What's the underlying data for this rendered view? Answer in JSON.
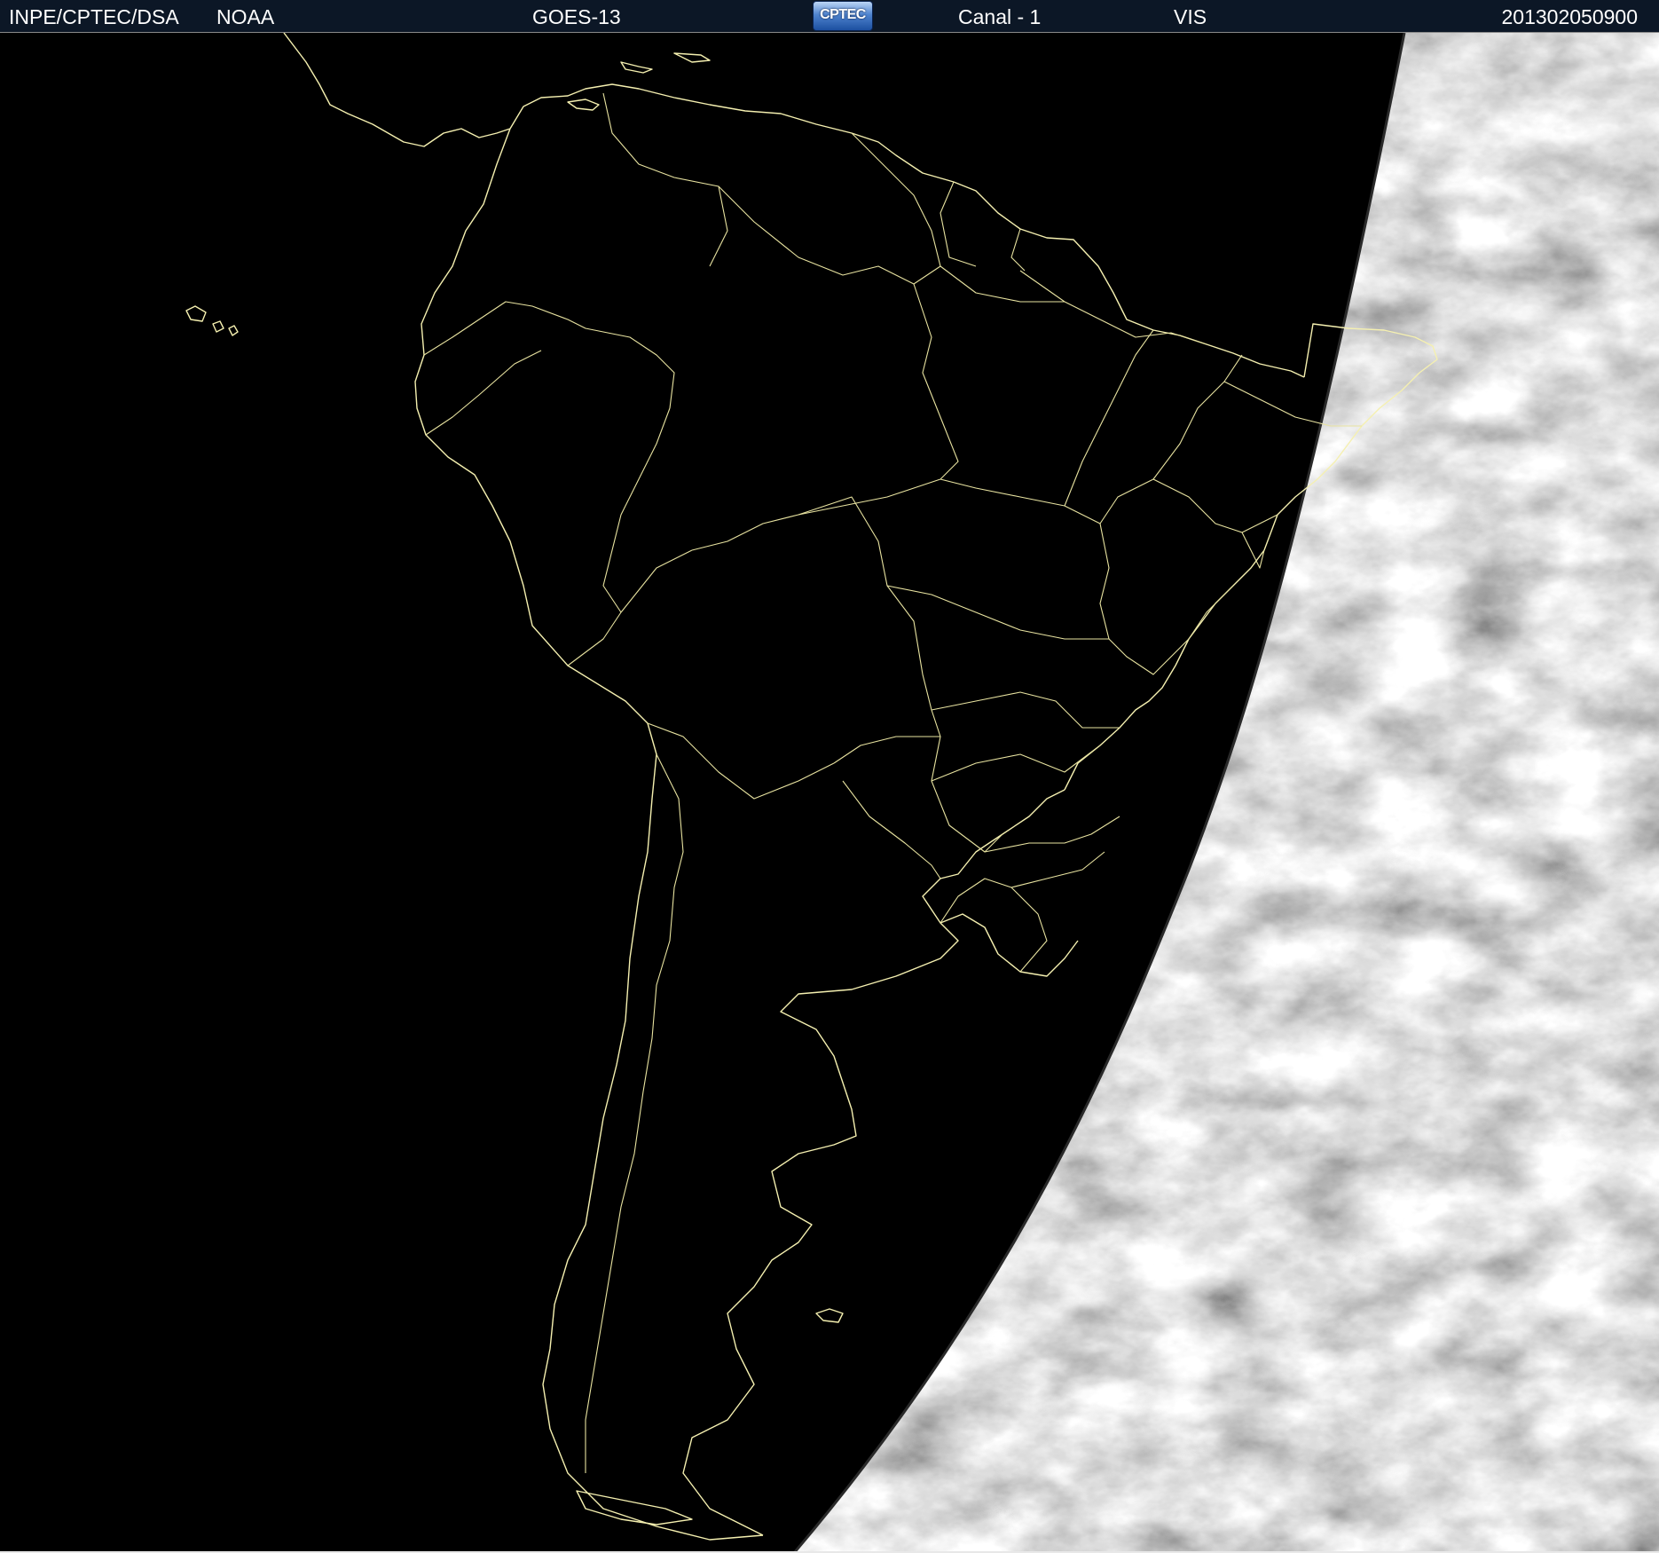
{
  "header": {
    "org": "INPE/CPTEC/DSA",
    "agency": "NOAA",
    "satellite": "GOES-13",
    "logo_text": "CPTEC",
    "channel": "Canal - 1",
    "band": "VIS",
    "timestamp": "201302050900"
  },
  "map": {
    "region": "South America",
    "projection_view": "satellite full disk sector",
    "colors": {
      "night_side": "#000000",
      "coastline": "#f5f0b0",
      "header_background": "#0c1726",
      "header_text": "#ffffff"
    },
    "layers": [
      "coastlines",
      "country-borders",
      "state-borders",
      "cloud-imagery"
    ]
  }
}
